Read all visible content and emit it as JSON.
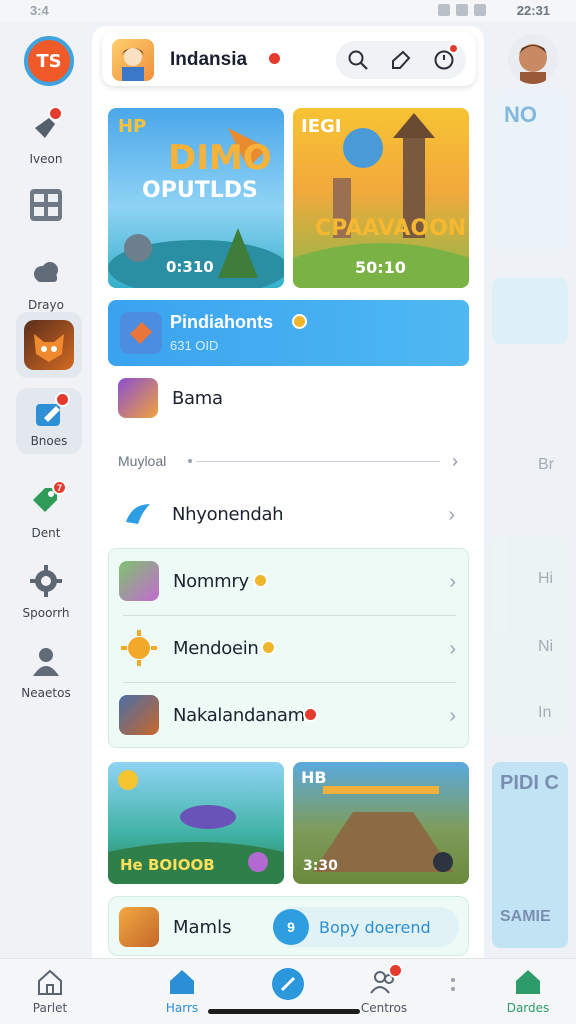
{
  "status_bar": {
    "time_left": "3:4",
    "time_right": "22:31"
  },
  "rail": {
    "logo_text": "TS",
    "items": [
      {
        "label": "Iveon",
        "icon": "pin-icon",
        "badge": true
      },
      {
        "label": "",
        "icon": "grid-icon",
        "badge": false
      },
      {
        "label": "Drayo",
        "icon": "cloud-icon",
        "badge": false
      },
      {
        "label": "",
        "icon": "fox-avatar-icon",
        "badge": false
      },
      {
        "label": "Bnoes",
        "icon": "edit-icon",
        "badge": true
      },
      {
        "label": "Dent",
        "icon": "tag-icon",
        "badge": "7"
      },
      {
        "label": "Spoorrh",
        "icon": "gear-icon",
        "badge": false
      },
      {
        "label": "Neaetos",
        "icon": "person-icon",
        "badge": false
      }
    ]
  },
  "header": {
    "title": "Indansia"
  },
  "cards": {
    "top_left": {
      "corner": "HP",
      "title": "DIMO",
      "subtitle": "OPUTLDS",
      "score": "0:310"
    },
    "top_right": {
      "corner": "IEGI",
      "title": "CPAAVAOON",
      "score": "50:10"
    },
    "bottom_left": {
      "label": "He BOIOOB"
    },
    "bottom_right": {
      "corner": "HB",
      "label": "3:30"
    }
  },
  "feature": {
    "title": "Pindiahonts",
    "subtitle": "631 OID"
  },
  "rows": {
    "bama": "Bama",
    "section": "Muyloal",
    "nhy": "Nhyonendah",
    "group": [
      "Nommry",
      "Mendoein",
      "Nakalandanam"
    ]
  },
  "bottom_card": {
    "label": "Mamls",
    "pill_icon_text": "9",
    "pill_text": "Bopy doerend"
  },
  "preview": {
    "title": "NO",
    "rows": [
      "Br",
      "Hi",
      "Ni",
      "In"
    ],
    "card_title": "PIDI C",
    "card_sub": "SAMIE"
  },
  "nav": [
    {
      "label": "Parlet",
      "icon": "house-outline-icon"
    },
    {
      "label": "Harrs",
      "icon": "home-icon"
    },
    {
      "label": "",
      "icon": "compass-icon"
    },
    {
      "label": "Centros",
      "icon": "people-icon"
    },
    {
      "label": "Dardes",
      "icon": "house-green-icon"
    }
  ],
  "colors": {
    "accent": "#2b8fd6",
    "badge": "#e53b2f",
    "feature_bg": "#3aa3f0",
    "group_bg": "#eefaf6"
  }
}
